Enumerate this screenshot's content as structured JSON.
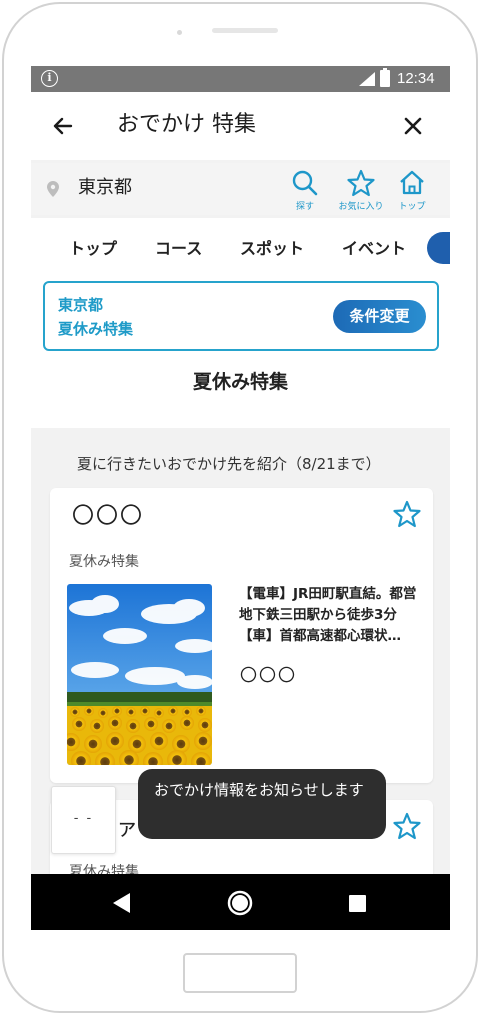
{
  "status_bar": {
    "time": "12:34",
    "info_glyph": "i"
  },
  "app_bar": {
    "title": "おでかけ 特集"
  },
  "location": {
    "value": "東京都",
    "actions": [
      {
        "label": "探す",
        "icon": "search-icon"
      },
      {
        "label": "お気に入り",
        "icon": "star-icon"
      },
      {
        "label": "トップ",
        "icon": "home-icon"
      }
    ]
  },
  "tabs": [
    {
      "label": "トップ"
    },
    {
      "label": "コース"
    },
    {
      "label": "スポット"
    },
    {
      "label": "イベント"
    }
  ],
  "filter": {
    "line1": "東京都",
    "line2": "夏休み特集",
    "button": "条件変更"
  },
  "section": {
    "title": "夏休み特集",
    "description": "夏に行きたいおでかけ先を紹介（8/21まで）"
  },
  "cards": [
    {
      "title": "〇〇〇",
      "tag": "夏休み特集",
      "access": "【電車】JR田町駅直結。都営地下鉄三田駅から徒歩3分【車】首都高速都心環状…",
      "name": "〇〇〇"
    },
    {
      "title": "ソファ",
      "tag": "夏休み特集"
    }
  ],
  "mini_widget": {
    "text": "- -"
  },
  "toast": {
    "message": "おでかけ情報をお知らせします"
  },
  "colors": {
    "accent": "#1e97c9",
    "button": "#1f6fb9",
    "status_bar": "#777777"
  }
}
